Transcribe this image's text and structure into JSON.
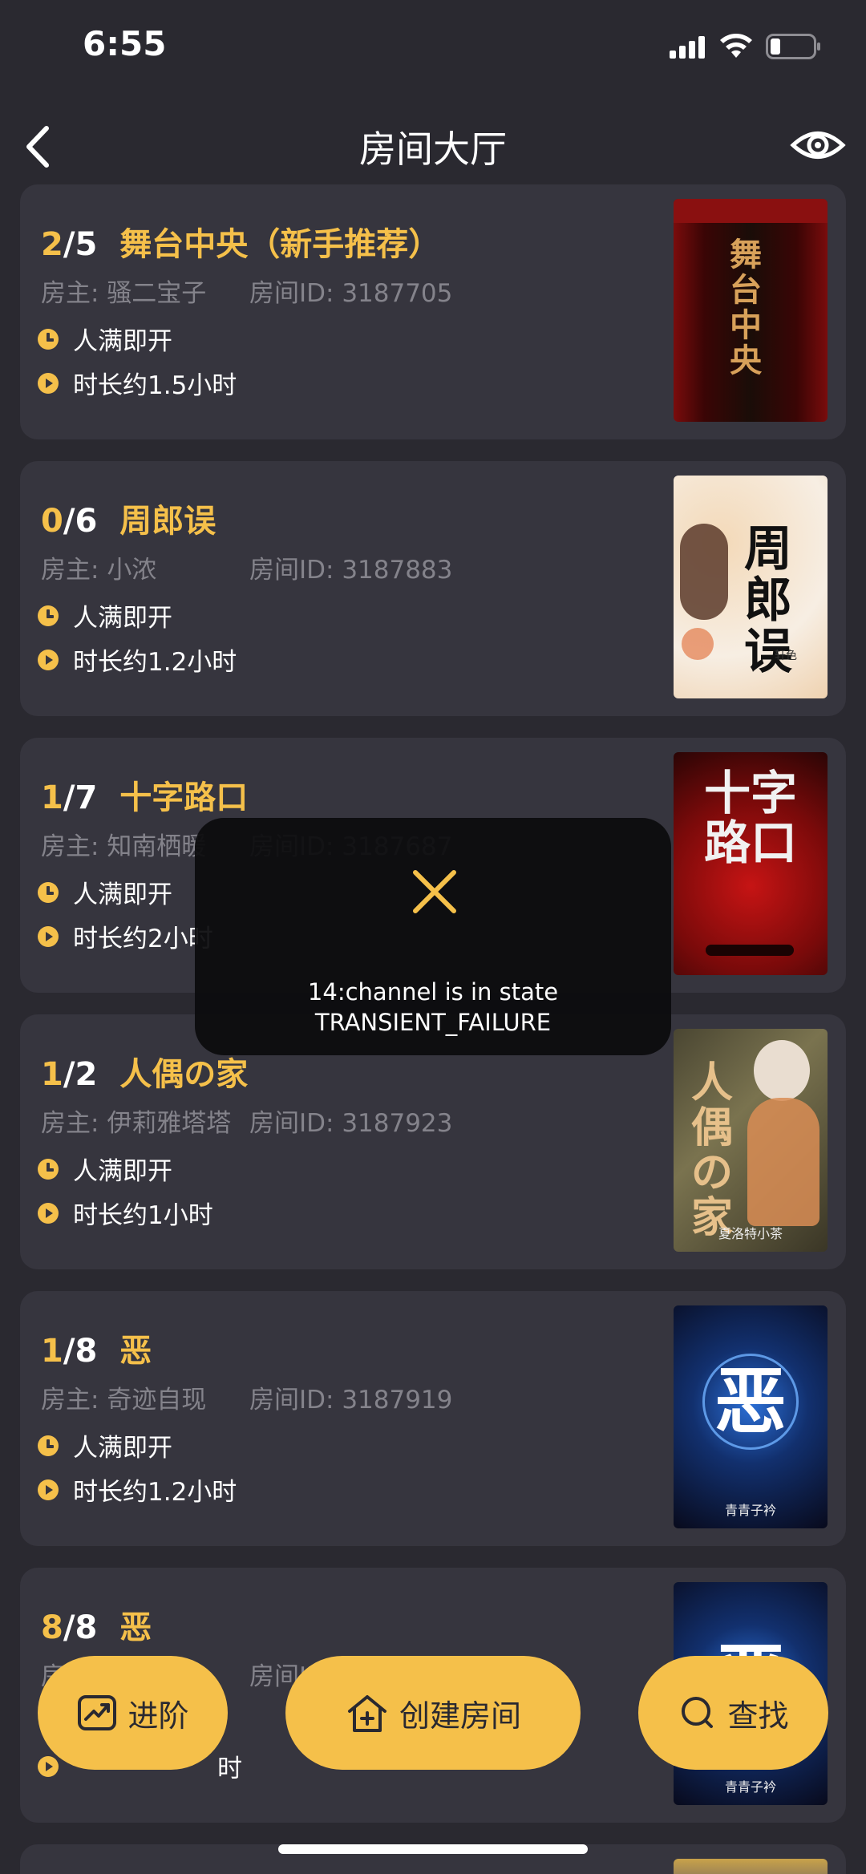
{
  "status": {
    "time": "6:55"
  },
  "nav": {
    "title": "房间大厅"
  },
  "labels": {
    "owner_prefix": "房主: ",
    "room_prefix": "房间ID: "
  },
  "rooms": [
    {
      "current": "2",
      "sep": "/",
      "capacity": "5",
      "name": "舞台中央（新手推荐）",
      "owner": "骚二宝子",
      "room_id": "3187705",
      "start": "人满即开",
      "duration": "时长约1.5小时",
      "cover_title": "舞台中央"
    },
    {
      "current": "0",
      "sep": "/",
      "capacity": "6",
      "name": "周郎误",
      "owner": "小浓",
      "room_id": "3187883",
      "start": "人满即开",
      "duration": "时长约1.2小时",
      "cover_title": "周郎误",
      "cover_credit": "轩色"
    },
    {
      "current": "1",
      "sep": "/",
      "capacity": "7",
      "name": "十字路口",
      "owner": "知南栖暖",
      "room_id": "3187687",
      "start": "人满即开",
      "duration": "时长约2小时",
      "cover_title": "十字路口"
    },
    {
      "current": "1",
      "sep": "/",
      "capacity": "2",
      "name": "人偶の家",
      "owner": "伊莉雅塔塔",
      "room_id": "3187923",
      "start": "人满即开",
      "duration": "时长约1小时",
      "cover_title": "人偶の家",
      "cover_credit": "夏洛特小茶"
    },
    {
      "current": "1",
      "sep": "/",
      "capacity": "8",
      "name": "恶",
      "owner": "奇迹自现",
      "room_id": "3187919",
      "start": "人满即开",
      "duration": "时长约1.2小时",
      "cover_title": "恶",
      "cover_credit": "青青子衿"
    },
    {
      "current": "8",
      "sep": "/",
      "capacity": "8",
      "name": "恶",
      "owner": "",
      "room_id": "",
      "start": "",
      "duration": "时",
      "cover_title": "恶",
      "cover_credit": "青青子衿"
    }
  ],
  "toast": {
    "line1": "14:channel is in state",
    "line2": "TRANSIENT_FAILURE"
  },
  "buttons": {
    "advance": "进阶",
    "create": "创建房间",
    "search": "查找"
  },
  "colors": {
    "accent": "#f5c04a",
    "background": "#2a2930",
    "card": "#36353e"
  }
}
